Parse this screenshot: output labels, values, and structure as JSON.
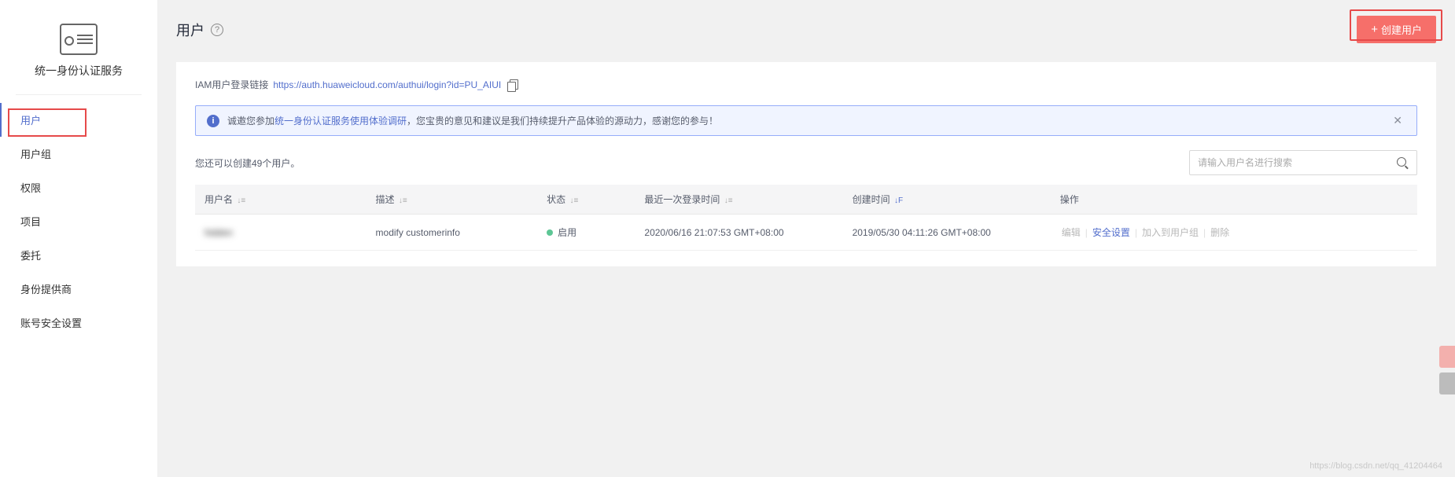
{
  "sidebar": {
    "service_name": "统一身份认证服务",
    "nav": [
      {
        "label": "用户",
        "active": true
      },
      {
        "label": "用户组"
      },
      {
        "label": "权限"
      },
      {
        "label": "项目"
      },
      {
        "label": "委托"
      },
      {
        "label": "身份提供商"
      },
      {
        "label": "账号安全设置"
      }
    ]
  },
  "header": {
    "title": "用户",
    "create_btn": "创建用户"
  },
  "card": {
    "login_link_label": "IAM用户登录链接",
    "login_link_url": "https://auth.huaweicloud.com/authui/login?id=PU_AIUI",
    "notice_prefix": "诚邀您参加",
    "notice_link": "统一身份认证服务使用体验调研",
    "notice_suffix": "，您宝贵的意见和建议是我们持续提升产品体验的源动力，感谢您的参与！",
    "remain_text": "您还可以创建49个用户。",
    "search_placeholder": "请输入用户名进行搜索"
  },
  "table": {
    "headers": {
      "username": "用户名",
      "desc": "描述",
      "status": "状态",
      "last_login": "最近一次登录时间",
      "create_time": "创建时间",
      "ops": "操作"
    },
    "rows": [
      {
        "username": "hidden",
        "desc": "modify customerinfo",
        "status": "启用",
        "last_login": "2020/06/16 21:07:53 GMT+08:00",
        "create_time": "2019/05/30 04:11:26 GMT+08:00"
      }
    ],
    "ops": {
      "edit": "编辑",
      "security": "安全设置",
      "add_group": "加入到用户组",
      "delete": "删除"
    }
  },
  "watermark": "https://blog.csdn.net/qq_41204464"
}
